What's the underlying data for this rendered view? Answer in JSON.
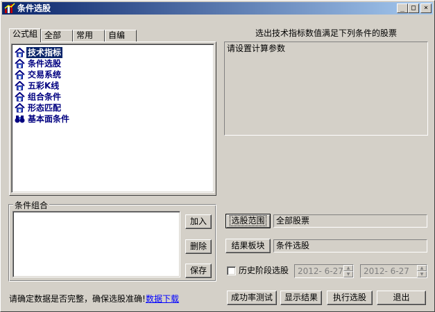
{
  "window": {
    "title": "条件选股",
    "controls": {
      "minimize": "_",
      "maximize": "□",
      "close": "×"
    }
  },
  "tabs": [
    {
      "label": "公式組",
      "active": true
    },
    {
      "label": "全部"
    },
    {
      "label": "常用"
    },
    {
      "label": "自编"
    }
  ],
  "tree": {
    "items": [
      {
        "label": "技术指标",
        "icon": "house-icon",
        "selected": true
      },
      {
        "label": "条件选股",
        "icon": "house-icon"
      },
      {
        "label": "交易系统",
        "icon": "house-icon"
      },
      {
        "label": "五彩K线",
        "icon": "house-icon"
      },
      {
        "label": "组合条件",
        "icon": "house-icon"
      },
      {
        "label": "形态匹配",
        "icon": "house-icon"
      },
      {
        "label": "基本面条件",
        "icon": "binoculars-icon"
      }
    ]
  },
  "formula": {
    "heading": "选出技术指标数值满足下列条件的股票",
    "param_text": "请设置计算参数"
  },
  "condition_group": {
    "label": "条件组合",
    "add": "加入",
    "delete": "删除",
    "save": "保存"
  },
  "range": {
    "button": "选股范围",
    "value": "全部股票"
  },
  "result_block": {
    "button": "结果板块",
    "value": "条件选股"
  },
  "history": {
    "label": "历史阶段选股",
    "checked": false,
    "start_date": "2012- 6-27",
    "end_date": "2012- 6-27"
  },
  "footer": {
    "notice": "请确定数据是否完整，确保选股准确!",
    "link": "数据下载",
    "success_test": "成功率测试",
    "show_result": "显示结果",
    "execute": "执行选股",
    "exit": "退出"
  },
  "colors": {
    "title_start": "#0a246a",
    "title_end": "#a6caf0",
    "tree_text": "#000080",
    "selection": "#0a246a",
    "face": "#d4d0c8"
  }
}
